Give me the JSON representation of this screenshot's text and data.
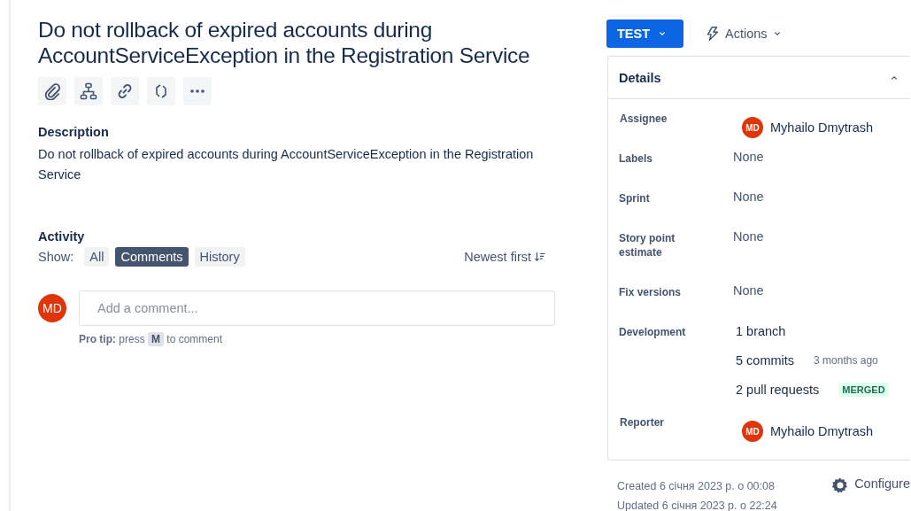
{
  "title": "Do not rollback of expired accounts during AccountServiceException in the Registration Service",
  "toolbar": [
    {
      "kind": "attach"
    },
    {
      "kind": "hierarchy"
    },
    {
      "kind": "link"
    },
    {
      "kind": "brackets"
    },
    {
      "kind": "more"
    }
  ],
  "description": {
    "heading": "Description",
    "text": "Do not rollback of expired accounts during AccountServiceException in the Registration Service"
  },
  "activity": {
    "heading": "Activity",
    "show_label": "Show:",
    "filters": [
      {
        "label": "All",
        "selected": false
      },
      {
        "label": "Comments",
        "selected": true
      },
      {
        "label": "History",
        "selected": false
      }
    ],
    "sort": "Newest first",
    "comment": {
      "avatar": "MD",
      "placeholder": "Add a comment...",
      "tip_bold": "Pro tip:",
      "tip_before": "press",
      "tip_key": "M",
      "tip_after": "to comment"
    }
  },
  "status_button": "TEST",
  "actions_button": "Actions",
  "details": {
    "heading": "Details",
    "expanded": true,
    "fields": [
      {
        "kind": "user",
        "label": "Assignee",
        "avatar": "MD",
        "value": "Myhailo Dmytrash"
      },
      {
        "kind": "text",
        "label": "Labels",
        "value": "None"
      },
      {
        "kind": "text",
        "label": "Sprint",
        "value": "None"
      },
      {
        "kind": "text",
        "label": "Story point estimate",
        "value": "None"
      },
      {
        "kind": "text",
        "label": "Fix versions",
        "value": "None"
      },
      {
        "kind": "development",
        "label": "Development",
        "items": [
          {
            "text": "1 branch"
          },
          {
            "text": "5 commits",
            "meta": "3 months ago"
          },
          {
            "text": "2 pull requests",
            "badge": "MERGED"
          }
        ]
      },
      {
        "kind": "user",
        "label": "Reporter",
        "avatar": "MD",
        "value": "Myhailo Dmytrash"
      }
    ]
  },
  "created": "Created 6 січня 2023 р. о 00:08",
  "updated": "Updated 6 січня 2023 р. о 22:24",
  "configure": "Configure"
}
